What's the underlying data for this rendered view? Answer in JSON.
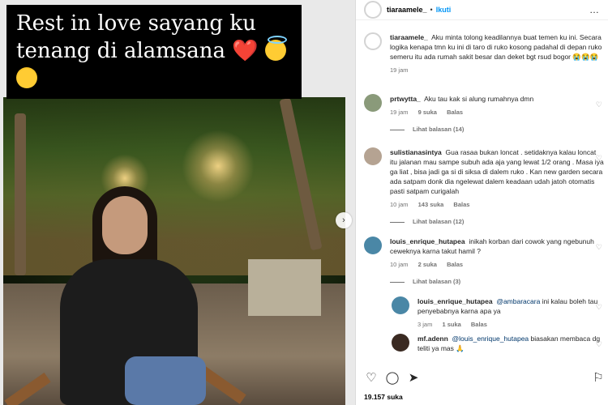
{
  "post": {
    "caption_overlay": {
      "line1": "Rest in love sayang ku",
      "line2": "tenang di alamsana",
      "heart": "❤️",
      "halo_icon": "smiling-face-with-halo-icon",
      "plead_icon": "pleading-face-icon"
    },
    "next_icon": "›"
  },
  "header": {
    "username": "tiaraamele_",
    "separator": "•",
    "follow_label": "Ikuti",
    "more_icon": "…"
  },
  "caption": {
    "username": "tiaraamele_",
    "text": "Aku minta tolong keadilannya buat temen ku ini. Secara logika kenapa tmn ku ini di taro di ruko kosong padahal di depan ruko semeru itu ada rumah sakit besar dan deket bgt rsud bogor",
    "emojis": "😭😭😭",
    "time": "19 jam"
  },
  "comments": [
    {
      "username": "prtwytta_",
      "text": "Aku tau kak si alung rumahnya dmn",
      "time": "19 jam",
      "likes": "9 suka",
      "reply": "Balas",
      "view_replies": "Lihat balasan (14)",
      "avatar_color": "#8a9a7a"
    },
    {
      "username": "sulistianasintya",
      "text": "Gua rasaa bukan loncat . setidaknya kalau loncat itu jalanan mau sampe subuh ada aja yang lewat 1/2 orang . Masa iya ga liat , bisa jadi ga si di siksa di dalem ruko . Kan new garden secara ada satpam donk dia ngelewat dalem keadaan udah jatoh otomatis pasti satpam curigalah",
      "time": "10 jam",
      "likes": "143 suka",
      "reply": "Balas",
      "view_replies": "Lihat balasan (12)",
      "avatar_color": "#b5a392"
    },
    {
      "username": "louis_enrique_hutapea",
      "text": "inikah korban dari cowok yang ngebunuh ceweknya karna takut hamil ?",
      "time": "10 jam",
      "likes": "2 suka",
      "reply": "Balas",
      "view_replies": "Lihat balasan (3)",
      "avatar_color": "#4a87a6"
    }
  ],
  "replies": [
    {
      "username": "louis_enrique_hutapea",
      "mention": "@ambaracara",
      "text": "ini kalau boleh tau penyebabnya karna apa ya",
      "time": "3 jam",
      "likes": "1 suka",
      "reply": "Balas",
      "avatar_color": "#4a87a6"
    },
    {
      "username": "mf.adenn",
      "mention": "@louis_enrique_hutapea",
      "text": "biasakan membaca dg teliti ya mas",
      "emoji": "🙏",
      "time": "",
      "likes": "",
      "reply": "",
      "avatar_color": "#3a2a22"
    }
  ],
  "actions": {
    "like_icon": "heart-outline-icon",
    "comment_icon": "comment-icon",
    "share_icon": "send-icon",
    "save_icon": "bookmark-icon"
  },
  "likes_count": "19.157",
  "likes_label": "suka",
  "colors": {
    "link": "#0095f6",
    "mention": "#00376b",
    "secondary": "#737373"
  }
}
